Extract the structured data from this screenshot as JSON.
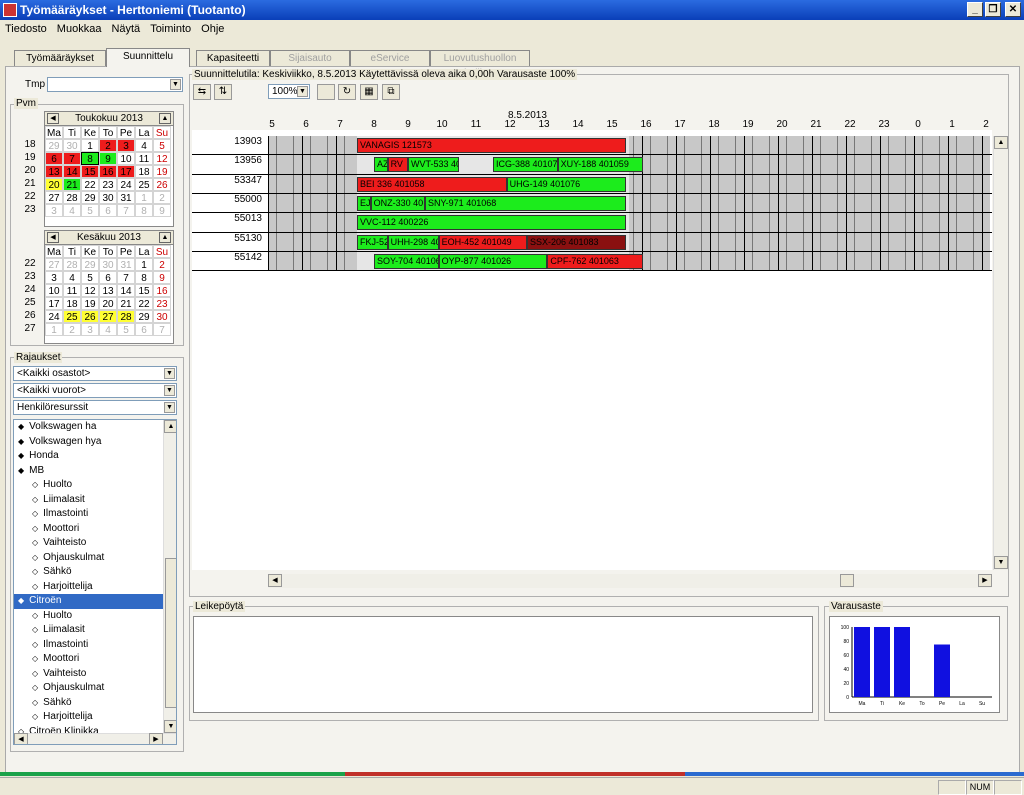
{
  "window": {
    "title": "Työmääräykset - Herttoniemi (Tuotanto)"
  },
  "menu": [
    "Tiedosto",
    "Muokkaa",
    "Näytä",
    "Toiminto",
    "Ohje"
  ],
  "tabs": [
    {
      "label": "Työmääräykset",
      "state": "normal"
    },
    {
      "label": "Suunnittelu",
      "state": "active"
    },
    {
      "label": "Kapasiteetti",
      "state": "normal"
    },
    {
      "label": "Sijaisauto",
      "state": "disabled"
    },
    {
      "label": "eService",
      "state": "disabled"
    },
    {
      "label": "Luovutushuollon hallinta",
      "state": "disabled"
    }
  ],
  "left": {
    "tmp_label": "Tmp",
    "pvm_label": "Pvm",
    "day_headers": [
      "Ma",
      "Ti",
      "Ke",
      "To",
      "Pe",
      "La",
      "Su"
    ],
    "cal1": {
      "month": "Toukokuu 2013",
      "weeks": [
        "18",
        "19",
        "20",
        "21",
        "22",
        "23"
      ],
      "days": [
        "29",
        "30",
        "1",
        "2",
        "3",
        "4",
        "5",
        "6",
        "7",
        "8",
        "9",
        "10",
        "11",
        "12",
        "13",
        "14",
        "15",
        "16",
        "17",
        "18",
        "19",
        "20",
        "21",
        "22",
        "23",
        "24",
        "25",
        "26",
        "27",
        "28",
        "29",
        "30",
        "31",
        "1",
        "2",
        "3",
        "4",
        "5",
        "6",
        "7",
        "8",
        "9"
      ]
    },
    "cal2": {
      "month": "Kesäkuu 2013",
      "weeks": [
        "22",
        "23",
        "24",
        "25",
        "26",
        "27"
      ],
      "days": [
        "27",
        "28",
        "29",
        "30",
        "31",
        "1",
        "2",
        "3",
        "4",
        "5",
        "6",
        "7",
        "8",
        "9",
        "10",
        "11",
        "12",
        "13",
        "14",
        "15",
        "16",
        "17",
        "18",
        "19",
        "20",
        "21",
        "22",
        "23",
        "24",
        "25",
        "26",
        "27",
        "28",
        "29",
        "30",
        "1",
        "2",
        "3",
        "4",
        "5",
        "6",
        "7"
      ]
    },
    "rajaukset_label": "Rajaukset",
    "filters": [
      "<Kaikki osastot>",
      "<Kaikki vuorot>",
      "Henkilöresurssit"
    ],
    "tree": [
      {
        "text": "Volkswagen ha",
        "level": 0,
        "mark": "◆"
      },
      {
        "text": "Volkswagen hya",
        "level": 0,
        "mark": "◆"
      },
      {
        "text": "Honda",
        "level": 0,
        "mark": "◆"
      },
      {
        "text": "MB",
        "level": 0,
        "mark": "◆"
      },
      {
        "text": "Huolto",
        "level": 1,
        "mark": "◇"
      },
      {
        "text": "Liimalasit",
        "level": 1,
        "mark": "◇"
      },
      {
        "text": "Ilmastointi",
        "level": 1,
        "mark": "◇"
      },
      {
        "text": "Moottori",
        "level": 1,
        "mark": "◇"
      },
      {
        "text": "Vaihteisto",
        "level": 1,
        "mark": "◇"
      },
      {
        "text": "Ohjauskulmat",
        "level": 1,
        "mark": "◇"
      },
      {
        "text": "Sähkö",
        "level": 1,
        "mark": "◇"
      },
      {
        "text": "Harjoittelija",
        "level": 1,
        "mark": "◇"
      },
      {
        "text": "Citroën",
        "level": 0,
        "mark": "◆",
        "selected": true
      },
      {
        "text": "Huolto",
        "level": 1,
        "mark": "◇"
      },
      {
        "text": "Liimalasit",
        "level": 1,
        "mark": "◇"
      },
      {
        "text": "Ilmastointi",
        "level": 1,
        "mark": "◇"
      },
      {
        "text": "Moottori",
        "level": 1,
        "mark": "◇"
      },
      {
        "text": "Vaihteisto",
        "level": 1,
        "mark": "◇"
      },
      {
        "text": "Ohjauskulmat",
        "level": 1,
        "mark": "◇"
      },
      {
        "text": "Sähkö",
        "level": 1,
        "mark": "◇"
      },
      {
        "text": "Harjoittelija",
        "level": 1,
        "mark": "◇"
      },
      {
        "text": "Citroën Klinikka",
        "level": 0,
        "mark": "◇"
      }
    ]
  },
  "planning": {
    "status": "Suunnittelutila: Keskiviikko, 8.5.2013 Käytettävissä oleva aika 0,00h Varausaste 100%",
    "zoom": "100%",
    "date_label": "8.5.2013",
    "hours": [
      "5",
      "6",
      "7",
      "8",
      "9",
      "10",
      "11",
      "12",
      "13",
      "14",
      "15",
      "16",
      "17",
      "18",
      "19",
      "20",
      "21",
      "22",
      "23",
      "0",
      "1",
      "2"
    ],
    "rows": [
      {
        "id": "13903",
        "bars": [
          {
            "start": 7.5,
            "end": 15.4,
            "color": "red",
            "text": "VANAGIS 121573"
          }
        ]
      },
      {
        "id": "13956",
        "bars": [
          {
            "start": 8.0,
            "end": 8.4,
            "color": "green",
            "text": "AZ"
          },
          {
            "start": 8.4,
            "end": 9.0,
            "color": "red",
            "text": "RV"
          },
          {
            "start": 9.0,
            "end": 10.5,
            "color": "green",
            "text": "WVT-533 401059"
          },
          {
            "start": 11.5,
            "end": 13.4,
            "color": "green",
            "text": "ICG-388 401070"
          },
          {
            "start": 13.4,
            "end": 15.9,
            "color": "green",
            "text": "XUY-188 401059"
          }
        ]
      },
      {
        "id": "53347",
        "bars": [
          {
            "start": 7.5,
            "end": 11.9,
            "color": "red",
            "text": "BEI 336 401058"
          },
          {
            "start": 11.9,
            "end": 15.4,
            "color": "green",
            "text": "UHG-149 401076"
          }
        ]
      },
      {
        "id": "55000",
        "bars": [
          {
            "start": 7.5,
            "end": 7.9,
            "color": "green",
            "text": "EJ"
          },
          {
            "start": 7.9,
            "end": 9.5,
            "color": "green",
            "text": "ONZ-330 40"
          },
          {
            "start": 9.5,
            "end": 15.4,
            "color": "green",
            "text": "SNY-971 401068"
          }
        ]
      },
      {
        "id": "55013",
        "bars": [
          {
            "start": 7.5,
            "end": 15.4,
            "color": "green",
            "text": "VVC-112 400226"
          }
        ]
      },
      {
        "id": "55130",
        "bars": [
          {
            "start": 7.5,
            "end": 8.4,
            "color": "green",
            "text": "FKJ-52"
          },
          {
            "start": 8.4,
            "end": 9.9,
            "color": "green",
            "text": "UHH-298 40"
          },
          {
            "start": 9.9,
            "end": 12.5,
            "color": "red",
            "text": "EOH-452 401049"
          },
          {
            "start": 12.5,
            "end": 15.4,
            "color": "dark",
            "text": "SSX-206 401083"
          }
        ]
      },
      {
        "id": "55142",
        "bars": [
          {
            "start": 8.0,
            "end": 9.9,
            "color": "green",
            "text": "SOY-704 401061"
          },
          {
            "start": 9.9,
            "end": 13.1,
            "color": "green",
            "text": "OYP-877 401026"
          },
          {
            "start": 13.1,
            "end": 15.9,
            "color": "red",
            "text": "CPF-762 401063"
          }
        ]
      }
    ]
  },
  "leikepoyta_label": "Leikepöytä",
  "varausaste": {
    "label": "Varausaste",
    "chart_data": {
      "type": "bar",
      "categories": [
        "Ma",
        "Ti",
        "Ke",
        "To",
        "Pe",
        "La",
        "Su"
      ],
      "values": [
        100,
        100,
        100,
        0,
        75,
        0,
        0
      ],
      "ylim": [
        0,
        100
      ],
      "yticks": [
        "0",
        "20",
        "40",
        "60",
        "80",
        "100"
      ],
      "color": "#1010e0"
    }
  },
  "statusbar": {
    "num": "NUM"
  },
  "colors": {
    "green": "#1cec1c",
    "red": "#ee1c1c",
    "dark": "#8a1010",
    "selected": "#316ac5",
    "today": "#ffff33"
  }
}
